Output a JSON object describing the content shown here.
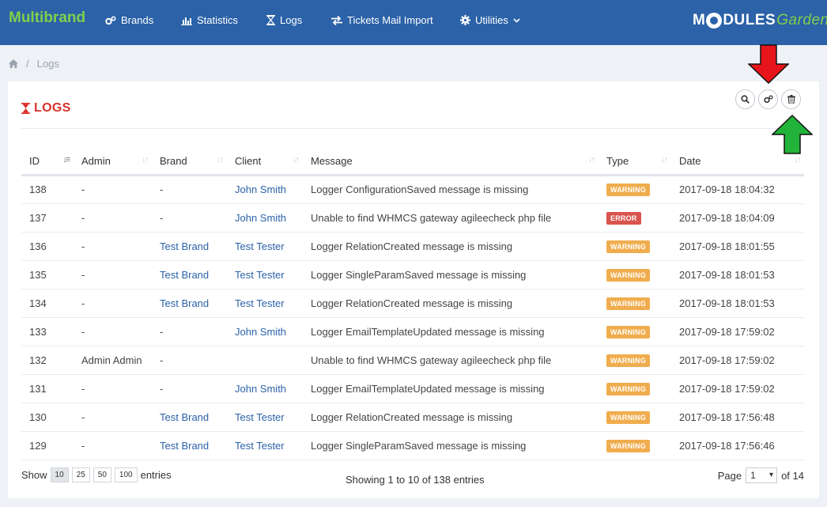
{
  "app": {
    "title": "Multibrand",
    "logo_text_1": "M",
    "logo_text_2": "DULES",
    "logo_text_3": "Garden"
  },
  "nav": {
    "brands": "Brands",
    "statistics": "Statistics",
    "logs": "Logs",
    "tickets": "Tickets Mail Import",
    "utilities": "Utilities"
  },
  "breadcrumb": {
    "separator": "/",
    "current": "Logs"
  },
  "panel": {
    "title": "LOGS"
  },
  "table": {
    "headers": {
      "id": "ID",
      "admin": "Admin",
      "brand": "Brand",
      "client": "Client",
      "message": "Message",
      "type": "Type",
      "date": "Date"
    },
    "rows": [
      {
        "id": "138",
        "admin": "-",
        "brand": "-",
        "client": "John Smith",
        "message": "Logger ConfigurationSaved message is missing",
        "type": "WARNING",
        "date": "2017-09-18 18:04:32"
      },
      {
        "id": "137",
        "admin": "-",
        "brand": "-",
        "client": "John Smith",
        "message": "Unable to find WHMCS gateway agileecheck php file",
        "type": "ERROR",
        "date": "2017-09-18 18:04:09"
      },
      {
        "id": "136",
        "admin": "-",
        "brand": "Test Brand",
        "client": "Test Tester",
        "message": "Logger RelationCreated message is missing",
        "type": "WARNING",
        "date": "2017-09-18 18:01:55"
      },
      {
        "id": "135",
        "admin": "-",
        "brand": "Test Brand",
        "client": "Test Tester",
        "message": "Logger SingleParamSaved message is missing",
        "type": "WARNING",
        "date": "2017-09-18 18:01:53"
      },
      {
        "id": "134",
        "admin": "-",
        "brand": "Test Brand",
        "client": "Test Tester",
        "message": "Logger RelationCreated message is missing",
        "type": "WARNING",
        "date": "2017-09-18 18:01:53"
      },
      {
        "id": "133",
        "admin": "-",
        "brand": "-",
        "client": "John Smith",
        "message": "Logger EmailTemplateUpdated message is missing",
        "type": "WARNING",
        "date": "2017-09-18 17:59:02"
      },
      {
        "id": "132",
        "admin": "Admin Admin",
        "brand": "-",
        "client": "",
        "message": "Unable to find WHMCS gateway agileecheck php file",
        "type": "WARNING",
        "date": "2017-09-18 17:59:02"
      },
      {
        "id": "131",
        "admin": "-",
        "brand": "-",
        "client": "John Smith",
        "message": "Logger EmailTemplateUpdated message is missing",
        "type": "WARNING",
        "date": "2017-09-18 17:59:02"
      },
      {
        "id": "130",
        "admin": "-",
        "brand": "Test Brand",
        "client": "Test Tester",
        "message": "Logger RelationCreated message is missing",
        "type": "WARNING",
        "date": "2017-09-18 17:56:48"
      },
      {
        "id": "129",
        "admin": "-",
        "brand": "Test Brand",
        "client": "Test Tester",
        "message": "Logger SingleParamSaved message is missing",
        "type": "WARNING",
        "date": "2017-09-18 17:56:46"
      }
    ]
  },
  "footer": {
    "show_label": "Show",
    "entries_label": "entries",
    "lengths": [
      "10",
      "25",
      "50",
      "100"
    ],
    "active_length": "10",
    "info": "Showing 1 to 10 of 138 entries",
    "page_label": "Page",
    "page_value": "1",
    "page_total": "of 14"
  },
  "colors": {
    "navbar": "#2b62a8",
    "brand_green": "#7fd04b",
    "title_red": "#d9302b",
    "warning": "#f0ad4e",
    "error": "#d9534f",
    "link": "#2b62a8",
    "annotation_red_arrow": "#e8141b",
    "annotation_green_arrow": "#22b43a"
  }
}
